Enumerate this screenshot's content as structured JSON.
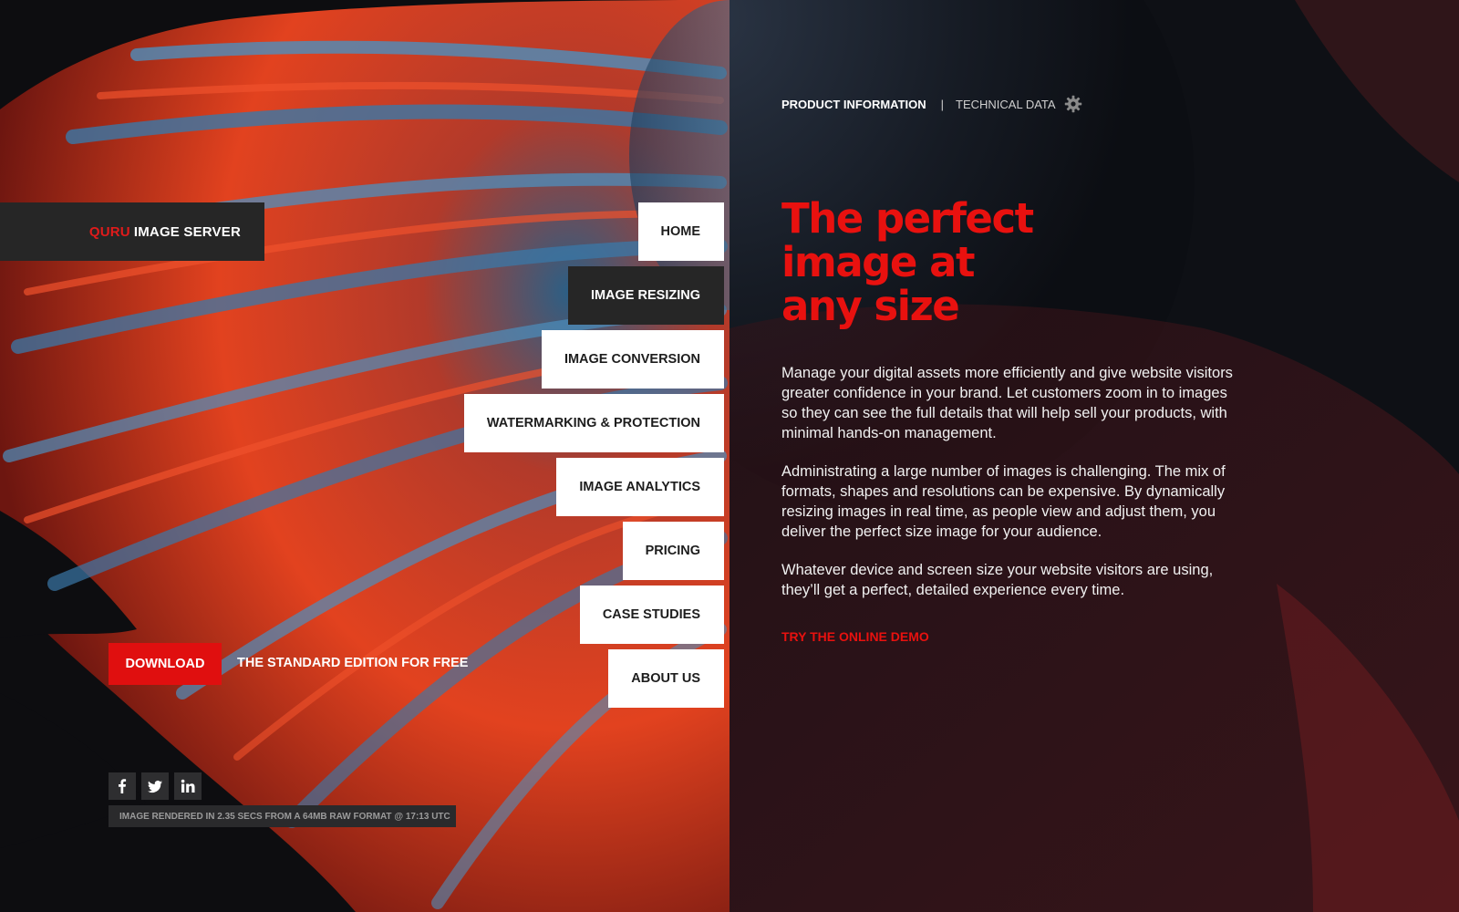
{
  "brand": {
    "accent": "QURU",
    "name": "IMAGE SERVER"
  },
  "nav": {
    "items": [
      {
        "label": "HOME",
        "active": false
      },
      {
        "label": "IMAGE RESIZING",
        "active": true
      },
      {
        "label": "IMAGE CONVERSION",
        "active": false
      },
      {
        "label": "WATERMARKING & PROTECTION",
        "active": false
      },
      {
        "label": "IMAGE ANALYTICS",
        "active": false
      },
      {
        "label": "PRICING",
        "active": false
      },
      {
        "label": "CASE STUDIES",
        "active": false
      },
      {
        "label": "ABOUT US",
        "active": false
      }
    ]
  },
  "download": {
    "button_label": "DOWNLOAD",
    "caption": "THE STANDARD EDITION FOR FREE"
  },
  "social": {
    "icons": [
      "facebook-icon",
      "twitter-icon",
      "linkedin-icon"
    ]
  },
  "render_info": "IMAGE RENDERED IN 2.35 SECS FROM A 64MB RAW FORMAT @ 17:13 UTC",
  "top_links": {
    "product": "PRODUCT INFORMATION",
    "separator": "|",
    "technical": "TECHNICAL DATA",
    "icon": "gear-icon"
  },
  "hero": {
    "title_lines": [
      "The perfect",
      "image at",
      "any size"
    ]
  },
  "paragraphs": [
    "Manage your digital assets more efficiently and give website visitors greater confidence in your brand. Let customers zoom in to images so they can see the full details that will help sell your products, with minimal hands-on management.",
    "Administrating a large number of images is challenging. The mix of formats, shapes and resolutions can be expensive. By dynamically resizing images in real time, as people view and adjust them, you deliver the perfect size image for your audience.",
    "Whatever device and screen size your website visitors are using, they’ll get a perfect, detailed experience every time."
  ],
  "demo_link": "TRY THE ONLINE DEMO",
  "colors": {
    "accent": "#e8110f",
    "dark_panel": "#262626",
    "background": "#0b0b0c"
  }
}
